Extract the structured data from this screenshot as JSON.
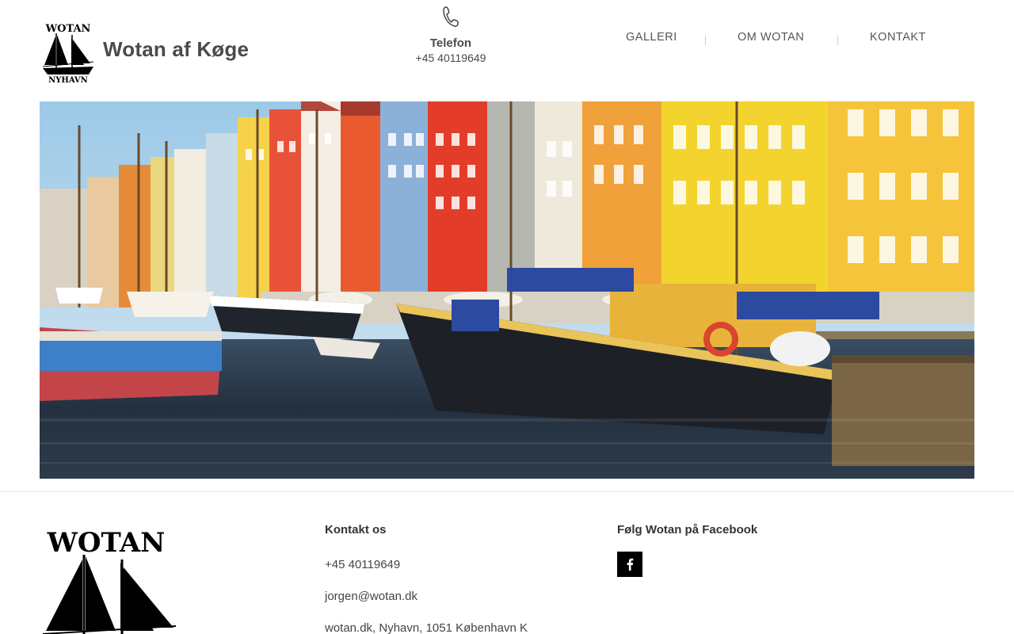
{
  "header": {
    "logo_text_top": "WOTAN",
    "logo_text_bottom": "NYHAVN",
    "site_title": "Wotan af Køge",
    "phone_label": "Telefon",
    "phone_number": "+45 40119649",
    "phone_icon": "phone-icon"
  },
  "nav": {
    "items": [
      {
        "label": "GALLERI"
      },
      {
        "label": "OM WOTAN"
      },
      {
        "label": "KONTAKT"
      }
    ]
  },
  "hero": {
    "image": "nyhavn-harbor-photo"
  },
  "footer": {
    "logo_text": "WOTAN",
    "contact": {
      "heading": "Kontakt os",
      "phone": "+45 40119649",
      "email": "jorgen@wotan.dk",
      "address": "wotan.dk, Nyhavn, 1051 København K"
    },
    "social": {
      "heading": "Følg Wotan på Facebook",
      "facebook_icon": "facebook-icon"
    }
  },
  "colors": {
    "text_dark": "#333333",
    "nav_text": "#555555",
    "footer_border": "#e6e6e6",
    "facebook_bg": "#000000"
  }
}
